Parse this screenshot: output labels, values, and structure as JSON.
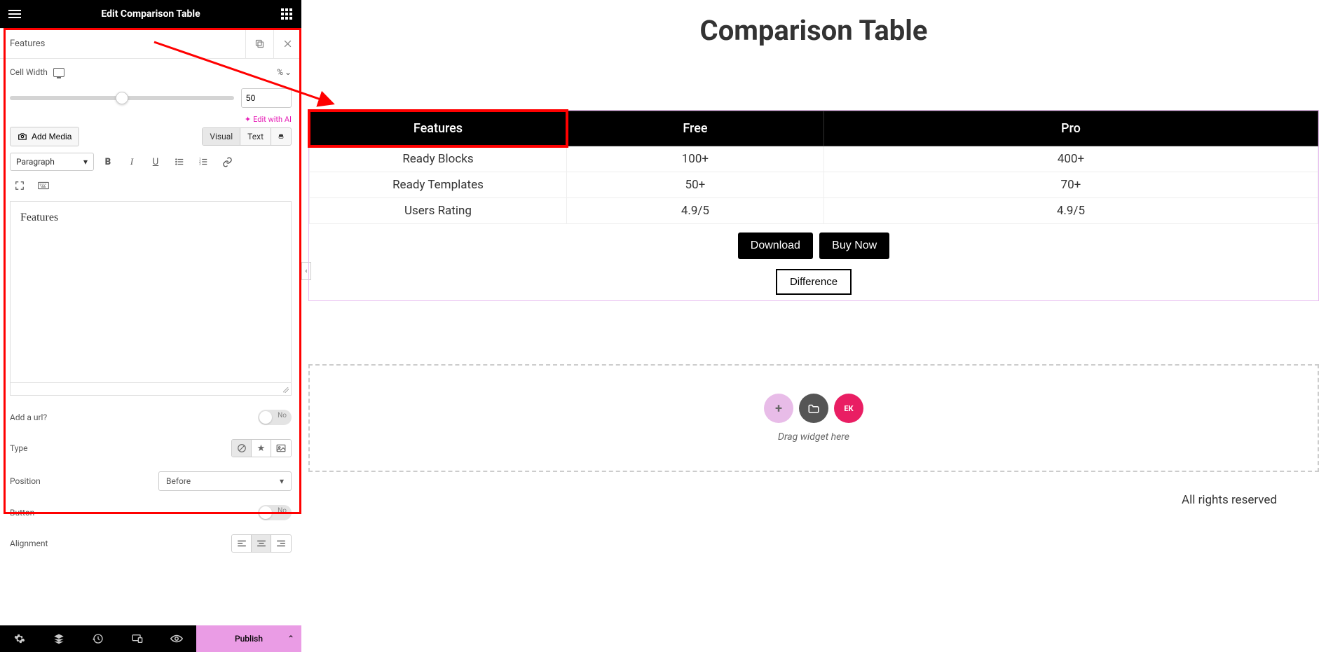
{
  "panel": {
    "title": "Edit Comparison Table",
    "section_title": "Features",
    "cell_width_label": "Cell Width",
    "cell_width_unit": "%",
    "cell_width_value": "50",
    "ai_link": "Edit with AI",
    "add_media": "Add Media",
    "editor_tabs": {
      "visual": "Visual",
      "text": "Text"
    },
    "paragraph": "Paragraph",
    "rte_content": "Features",
    "add_url_label": "Add a url?",
    "add_url_no": "No",
    "type_label": "Type",
    "position_label": "Position",
    "position_value": "Before",
    "button_label": "Button",
    "button_no": "No",
    "alignment_label": "Alignment"
  },
  "bottombar": {
    "publish": "Publish"
  },
  "canvas": {
    "page_title": "Comparison Table",
    "headers": [
      "Features",
      "Free",
      "Pro"
    ],
    "rows": [
      {
        "f": "Ready Blocks",
        "a": "100+",
        "b": "400+"
      },
      {
        "f": "Ready Templates",
        "a": "50+",
        "b": "70+"
      },
      {
        "f": "Users Rating",
        "a": "4.9/5",
        "b": "4.9/5"
      }
    ],
    "download": "Download",
    "buynow": "Buy Now",
    "difference": "Difference",
    "drop_hint": "Drag widget here",
    "footer": "All rights reserved"
  }
}
